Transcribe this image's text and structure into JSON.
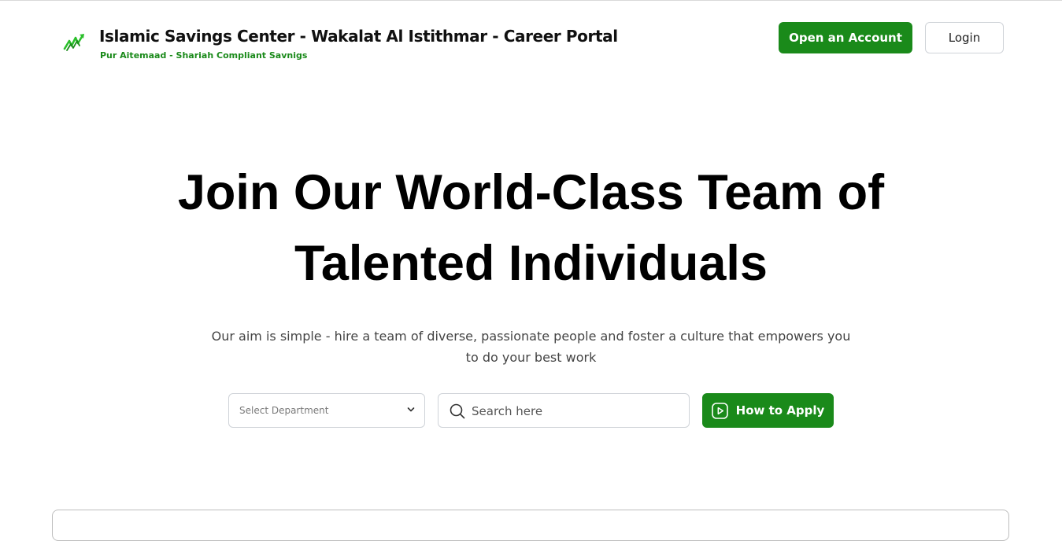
{
  "header": {
    "title": "Islamic Savings Center - Wakalat Al Istithmar - Career Portal",
    "subtitle": "Pur Aitemaad - Shariah Compliant Savnigs",
    "open_account_label": "Open an Account",
    "login_label": "Login",
    "logo_icon": "growth-chart-icon"
  },
  "hero": {
    "title_line1": "Join Our World-Class Team of",
    "title_line2": "Talented Individuals",
    "subtitle": "Our aim is simple - hire a team of diverse, passionate people and foster a culture that empowers you to do your best work"
  },
  "filters": {
    "department_placeholder": "Select Department",
    "search_placeholder": "Search here",
    "how_to_apply_label": "How to Apply"
  },
  "colors": {
    "brand_green": "#1a8a1a",
    "logo_green": "#2bbf2b"
  }
}
